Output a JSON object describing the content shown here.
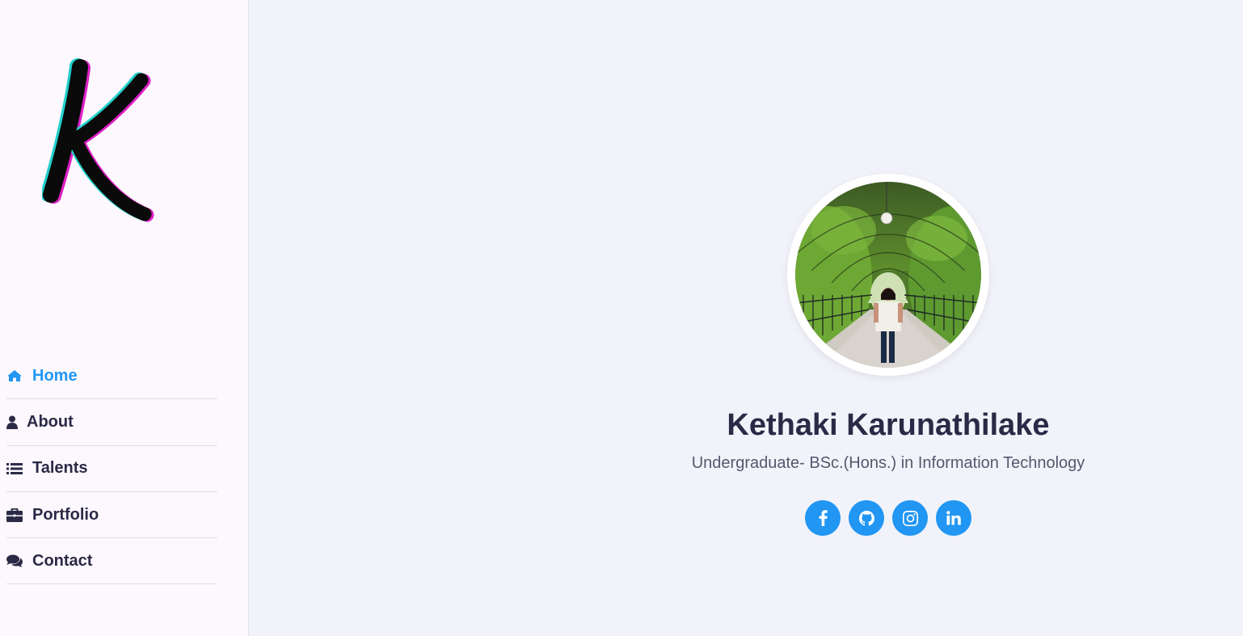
{
  "brand": {
    "logo_letter": "K"
  },
  "nav": {
    "items": [
      {
        "label": "Home",
        "icon": "home-icon",
        "active": true
      },
      {
        "label": "About",
        "icon": "user-icon",
        "active": false
      },
      {
        "label": "Talents",
        "icon": "list-icon",
        "active": false
      },
      {
        "label": "Portfolio",
        "icon": "briefcase-icon",
        "active": false
      },
      {
        "label": "Contact",
        "icon": "chat-icon",
        "active": false
      }
    ]
  },
  "profile": {
    "name": "Kethaki Karunathilake",
    "subtitle": "Undergraduate- BSc.(Hons.) in Information Technology"
  },
  "socials": [
    {
      "icon": "facebook-icon"
    },
    {
      "icon": "github-icon"
    },
    {
      "icon": "instagram-icon"
    },
    {
      "icon": "linkedin-icon"
    }
  ],
  "colors": {
    "accent": "#2196f3",
    "text_dark": "#2b2a46",
    "sidebar_bg": "#fdf8fd",
    "main_bg": "#f2f3fa"
  }
}
